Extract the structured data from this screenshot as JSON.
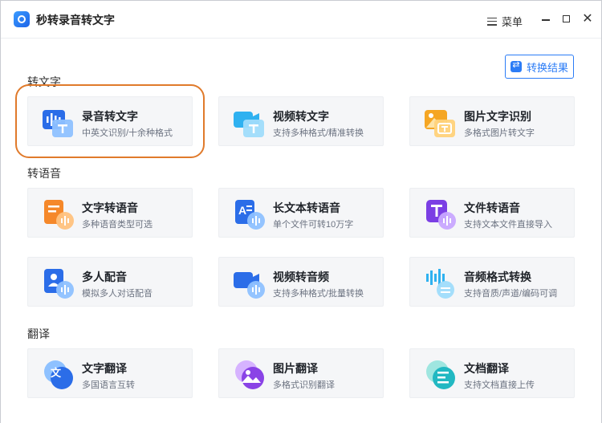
{
  "app": {
    "title": "秒转录音转文字",
    "menu_label": "菜单",
    "close_glyph": "✕"
  },
  "toolbar": {
    "result_label": "转换结果"
  },
  "sections": [
    {
      "title": "转文字",
      "cards": [
        {
          "title": "录音转文字",
          "sub": "中英文识别/十余种格式",
          "icon": "audio-to-text-icon"
        },
        {
          "title": "视频转文字",
          "sub": "支持多种格式/精准转换",
          "icon": "video-to-text-icon"
        },
        {
          "title": "图片文字识别",
          "sub": "多格式图片转文字",
          "icon": "image-ocr-icon"
        }
      ]
    },
    {
      "title": "转语音",
      "cards": [
        {
          "title": "文字转语音",
          "sub": "多种语音类型可选",
          "icon": "text-to-speech-icon"
        },
        {
          "title": "长文本转语音",
          "sub": "单个文件可转10万字",
          "icon": "long-text-to-speech-icon"
        },
        {
          "title": "文件转语音",
          "sub": "支持文本文件直接导入",
          "icon": "file-to-speech-icon"
        },
        {
          "title": "多人配音",
          "sub": "模拟多人对话配音",
          "icon": "multi-voice-icon"
        },
        {
          "title": "视频转音频",
          "sub": "支持多种格式/批量转换",
          "icon": "video-to-audio-icon"
        },
        {
          "title": "音频格式转换",
          "sub": "支持音质/声道/编码可调",
          "icon": "audio-format-icon"
        }
      ]
    },
    {
      "title": "翻译",
      "cards": [
        {
          "title": "文字翻译",
          "sub": "多国语言互转",
          "icon": "text-translate-icon"
        },
        {
          "title": "图片翻译",
          "sub": "多格式识别翻译",
          "icon": "image-translate-icon"
        },
        {
          "title": "文档翻译",
          "sub": "支持文档直接上传",
          "icon": "document-translate-icon"
        }
      ]
    }
  ],
  "colors": {
    "accent": "#2b7cf6",
    "highlight": "#e07a2b"
  }
}
